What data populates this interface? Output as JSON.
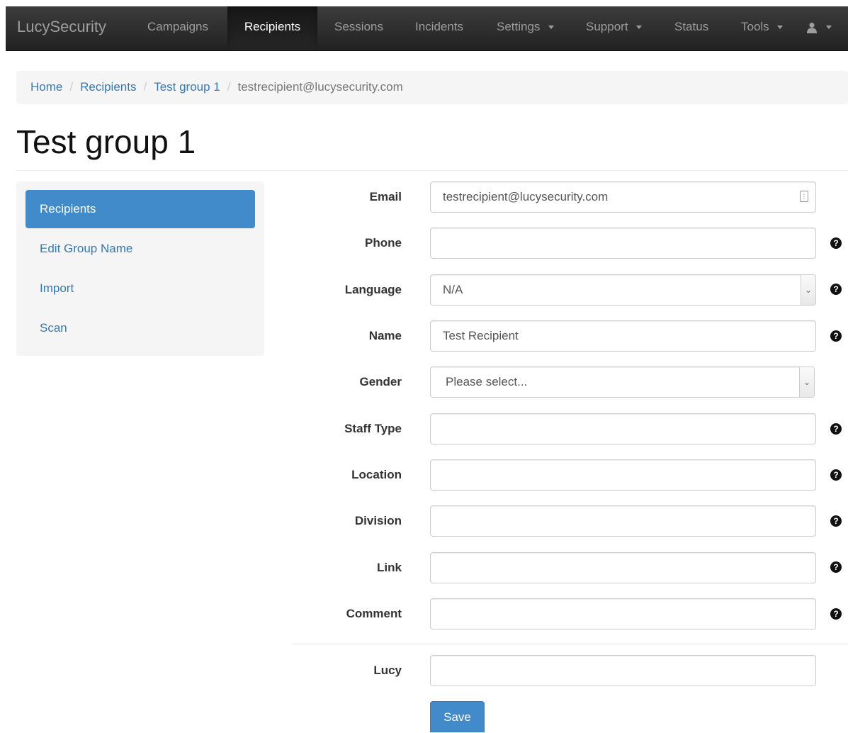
{
  "navbar": {
    "brand": "LucySecurity",
    "items": [
      {
        "label": "Campaigns"
      },
      {
        "label": "Recipients"
      },
      {
        "label": "Sessions"
      },
      {
        "label": "Incidents"
      },
      {
        "label": "Settings"
      },
      {
        "label": "Support"
      },
      {
        "label": "Status"
      },
      {
        "label": "Tools"
      }
    ],
    "user_icon": "user-icon"
  },
  "breadcrumb": {
    "items": [
      "Home",
      "Recipients",
      "Test group 1"
    ],
    "current": "testrecipient@lucysecurity.com",
    "separator": "/"
  },
  "page": {
    "title": "Test group 1"
  },
  "sidebar": {
    "items": [
      {
        "label": "Recipients"
      },
      {
        "label": "Edit Group Name"
      },
      {
        "label": "Import"
      },
      {
        "label": "Scan"
      }
    ]
  },
  "form": {
    "email": {
      "label": "Email",
      "value": "testrecipient@lucysecurity.com"
    },
    "phone": {
      "label": "Phone",
      "value": ""
    },
    "language": {
      "label": "Language",
      "value": "N/A"
    },
    "name": {
      "label": "Name",
      "value": "Test Recipient"
    },
    "gender": {
      "label": "Gender",
      "value": "Please select..."
    },
    "staff_type": {
      "label": "Staff Type",
      "value": ""
    },
    "location": {
      "label": "Location",
      "value": ""
    },
    "division": {
      "label": "Division",
      "value": ""
    },
    "link": {
      "label": "Link",
      "value": ""
    },
    "comment": {
      "label": "Comment",
      "value": ""
    },
    "lucy": {
      "label": "Lucy",
      "value": ""
    },
    "save_label": "Save",
    "help_glyph": "?"
  },
  "colors": {
    "navbar_bg": "#222222",
    "accent": "#428bca",
    "link": "#337ab7"
  }
}
